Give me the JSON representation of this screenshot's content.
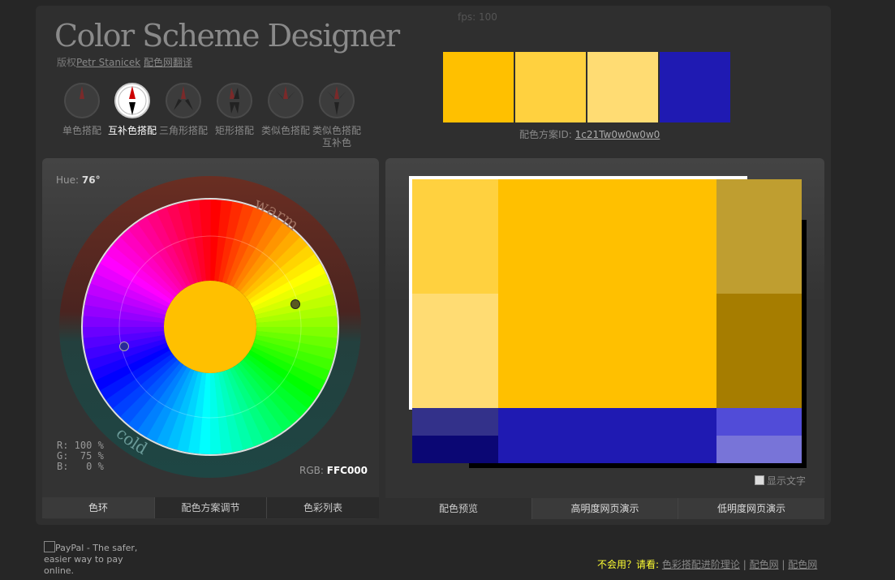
{
  "fps": "fps: 100",
  "title": "Color Scheme Designer",
  "copyright": {
    "prefix": "版权",
    "author": "Petr Stanicek",
    "translator": "配色网翻译"
  },
  "modes": [
    {
      "label": "单色搭配",
      "active": false
    },
    {
      "label": "互补色搭配",
      "active": true
    },
    {
      "label": "三角形搭配",
      "active": false
    },
    {
      "label": "矩形搭配",
      "active": false
    },
    {
      "label": "类似色搭配",
      "active": false
    },
    {
      "label": "类似色搭配互补色",
      "active": false
    }
  ],
  "swatches": [
    "#FFC000",
    "#FFD13F",
    "#FFDC73",
    "#1F1AB2"
  ],
  "scheme_id": {
    "label": "配色方案ID:",
    "value": "1c21Tw0w0w0w0"
  },
  "wheel": {
    "hue_label": "Hue:",
    "hue_value": "76°",
    "warm": "warm",
    "cold": "cold",
    "center_color": "#FFC000",
    "rgb_r": "R: 100 %",
    "rgb_g": "G:  75 %",
    "rgb_b": "B:   0 %",
    "rgb_hex_label": "RGB:",
    "rgb_hex_value": "FFC000"
  },
  "left_tabs": [
    "色环",
    "配色方案调节",
    "色彩列表"
  ],
  "right_tabs": [
    "配色预览",
    "高明度网页演示",
    "低明度网页演示"
  ],
  "preview_colors": {
    "primary": "#FFC000",
    "primary_light1": "#FFD13F",
    "primary_light2": "#FFDC73",
    "primary_dark1": "#BF9E30",
    "primary_dark2": "#A67D00",
    "comp": "#1F1AB2",
    "comp_dark1": "#33318A",
    "comp_dark2": "#0B0774",
    "comp_light1": "#514CD8",
    "comp_light2": "#7874D8"
  },
  "show_text": "显示文字",
  "paypal_alt": "PayPal - The safer, easier way to pay online.",
  "footer": {
    "question": "不会用？请看:",
    "link1": "色彩搭配进阶理论",
    "link2": "配色网",
    "link3": "配色网"
  }
}
